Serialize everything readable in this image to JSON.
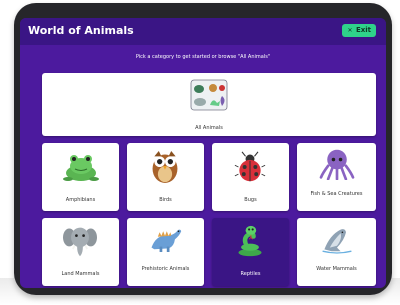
{
  "app": {
    "title": "World of Animals",
    "exit_label": "Exit",
    "instruction": "Pick a category to get started or browse \"All Animals\""
  },
  "categories": [
    {
      "label": "All Animals",
      "icon": "animal-collage-icon",
      "selected": false
    },
    {
      "label": "Amphibians",
      "icon": "frog-icon",
      "selected": false
    },
    {
      "label": "Birds",
      "icon": "owl-icon",
      "selected": false
    },
    {
      "label": "Bugs",
      "icon": "ladybug-icon",
      "selected": false
    },
    {
      "label": "Fish & Sea Creatures",
      "icon": "octopus-icon",
      "selected": false
    },
    {
      "label": "Land Mammals",
      "icon": "elephant-icon",
      "selected": false
    },
    {
      "label": "Prehistoric Animals",
      "icon": "dinosaur-icon",
      "selected": false
    },
    {
      "label": "Reptiles",
      "icon": "snake-icon",
      "selected": true
    },
    {
      "label": "Water Mammals",
      "icon": "whale-icon",
      "selected": false
    }
  ],
  "colors": {
    "background": "#4c1a9e",
    "header": "#3a1585",
    "exit_button": "#2fd28a",
    "selected_tile": "#3a1585"
  }
}
